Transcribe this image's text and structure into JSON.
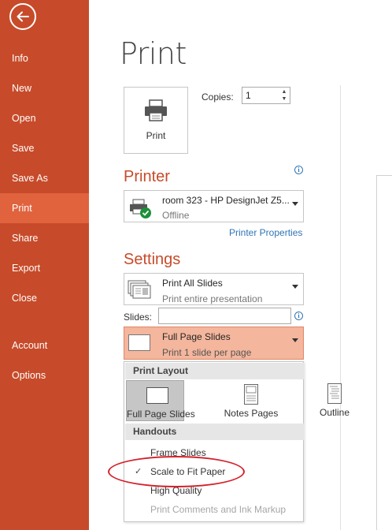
{
  "sidebar": {
    "back_icon": "arrow-left-icon",
    "items": [
      {
        "label": "Info"
      },
      {
        "label": "New"
      },
      {
        "label": "Open"
      },
      {
        "label": "Save"
      },
      {
        "label": "Save As"
      },
      {
        "label": "Print",
        "active": true
      },
      {
        "label": "Share"
      },
      {
        "label": "Export"
      },
      {
        "label": "Close"
      },
      {
        "label": "Account"
      },
      {
        "label": "Options"
      }
    ]
  },
  "main": {
    "title": "Print",
    "print_button": "Print",
    "copies_label": "Copies:",
    "copies_value": "1"
  },
  "printer": {
    "heading": "Printer",
    "name": "room 323 - HP DesignJet Z5...",
    "status": "Offline",
    "properties_link": "Printer Properties"
  },
  "settings": {
    "heading": "Settings",
    "range": {
      "title": "Print All Slides",
      "subtitle": "Print entire presentation"
    },
    "slides_label": "Slides:",
    "slides_value": "",
    "layout": {
      "title": "Full Page Slides",
      "subtitle": "Print 1 slide per page"
    }
  },
  "popup": {
    "print_layout_header": "Print Layout",
    "layouts": [
      {
        "label": "Full Page Slides",
        "selected": true
      },
      {
        "label": "Notes Pages"
      },
      {
        "label": "Outline"
      }
    ],
    "handouts_header": "Handouts",
    "options": [
      {
        "label": "Frame Slides",
        "checked": false,
        "disabled": false
      },
      {
        "label": "Scale to Fit Paper",
        "checked": true,
        "disabled": false
      },
      {
        "label": "High Quality",
        "checked": false,
        "disabled": false
      },
      {
        "label": "Print Comments and Ink Markup",
        "checked": false,
        "disabled": true
      }
    ],
    "check_glyph": "✓"
  },
  "colors": {
    "sidebar": "#c74b2a",
    "sidebar_active": "#e0633e",
    "accent": "#c74b2a",
    "link": "#2e75b6",
    "annotation": "#d3212b",
    "layout_highlight": "#f4b69c"
  }
}
